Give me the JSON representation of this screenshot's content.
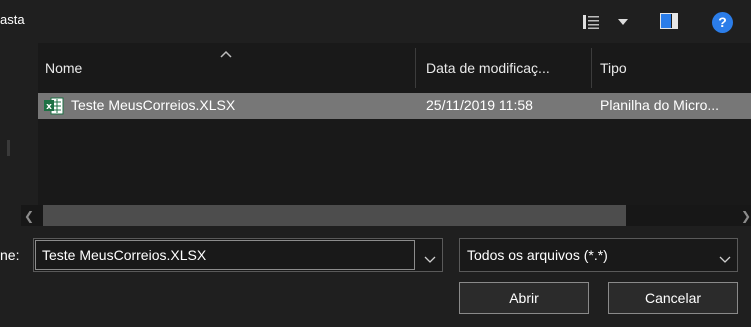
{
  "toolbar": {
    "label": "asta",
    "view_icon": "view-details-icon",
    "pane_icon": "preview-pane-icon",
    "help_icon": "help-icon",
    "help_text": "?"
  },
  "file_list": {
    "columns": [
      "Nome",
      "Data de modificaç...",
      "Tipo"
    ],
    "rows": [
      {
        "name": "Teste MeusCorreios.XLSX",
        "modified": "25/11/2019 11:58",
        "type": "Planilha do Micro...",
        "icon": "excel-file-icon",
        "selected": true
      }
    ]
  },
  "bottom": {
    "filename_label": "ne:",
    "filename_value": "Teste MeusCorreios.XLSX",
    "filter_value": "Todos os arquivos (*.*)",
    "open_label": "Abrir",
    "cancel_label": "Cancelar"
  },
  "colors": {
    "background": "#1f1f1f",
    "list_background": "#191919",
    "selected_row": "#777777",
    "accent": "#2b7de9",
    "excel_green": "#1e7145"
  }
}
